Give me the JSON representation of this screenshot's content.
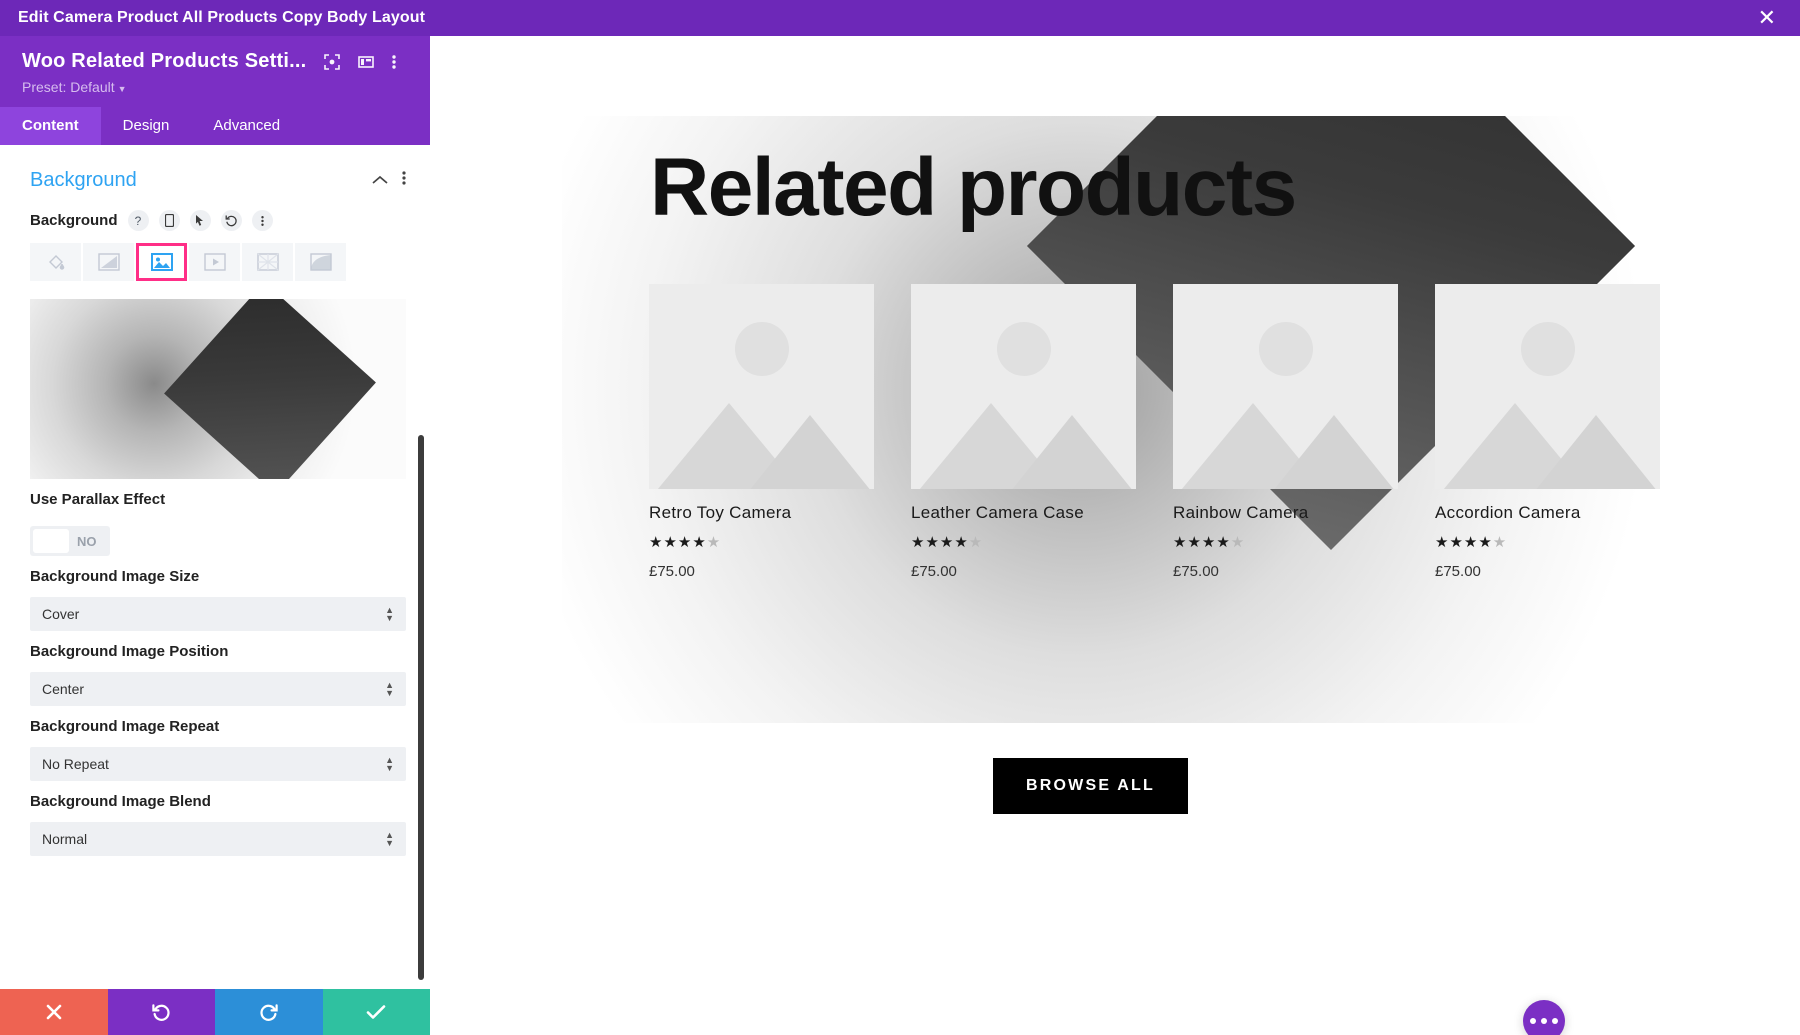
{
  "topbar": {
    "title": "Edit Camera Product All Products Copy Body Layout",
    "close_icon": "close-icon",
    "background_color": "#6D28B8"
  },
  "panel": {
    "module_title": "Woo Related Products Setti...",
    "preset_label": "Preset: Default",
    "header_icons": [
      {
        "name": "focus-target-icon"
      },
      {
        "name": "layout-columns-icon"
      },
      {
        "name": "more-vertical-icon"
      }
    ],
    "tabs": [
      {
        "label": "Content",
        "active": true
      },
      {
        "label": "Design",
        "active": false
      },
      {
        "label": "Advanced",
        "active": false
      }
    ],
    "section": {
      "title": "Background",
      "collapse_icon": "chevron-up-icon",
      "options_icon": "more-vertical-icon"
    },
    "background_field": {
      "label": "Background",
      "mini_icons": [
        {
          "name": "help-icon",
          "glyph": "?"
        },
        {
          "name": "responsive-mobile-icon"
        },
        {
          "name": "hover-cursor-icon"
        },
        {
          "name": "reset-undo-icon"
        },
        {
          "name": "more-vertical-icon"
        }
      ],
      "types": [
        {
          "name": "background-color-icon",
          "selected": false
        },
        {
          "name": "background-gradient-icon",
          "selected": false
        },
        {
          "name": "background-image-icon",
          "selected": true
        },
        {
          "name": "background-video-icon",
          "selected": false
        },
        {
          "name": "background-pattern-icon",
          "selected": false
        },
        {
          "name": "background-mask-icon",
          "selected": false
        }
      ],
      "selected_highlight_color": "#FF2E87"
    },
    "parallax": {
      "label": "Use Parallax Effect",
      "value": "NO"
    },
    "selects": [
      {
        "label": "Background Image Size",
        "value": "Cover"
      },
      {
        "label": "Background Image Position",
        "value": "Center"
      },
      {
        "label": "Background Image Repeat",
        "value": "No Repeat"
      },
      {
        "label": "Background Image Blend",
        "value": "Normal"
      }
    ],
    "actions": [
      {
        "name": "cancel-button",
        "icon": "close-icon",
        "color": "#EE6352"
      },
      {
        "name": "undo-button",
        "icon": "undo-icon",
        "color": "#7B2FC4"
      },
      {
        "name": "redo-button",
        "icon": "redo-icon",
        "color": "#2C8FD8"
      },
      {
        "name": "save-button",
        "icon": "check-icon",
        "color": "#2FC1A0"
      }
    ]
  },
  "preview": {
    "heading": "Related products",
    "products": [
      {
        "name": "Retro Toy Camera",
        "rating_filled": 4,
        "rating_total": 5,
        "price": "£75.00"
      },
      {
        "name": "Leather Camera Case",
        "rating_filled": 4,
        "rating_total": 5,
        "price": "£75.00"
      },
      {
        "name": "Rainbow Camera",
        "rating_filled": 4,
        "rating_total": 5,
        "price": "£75.00"
      },
      {
        "name": "Accordion Camera",
        "rating_filled": 4,
        "rating_total": 5,
        "price": "£75.00"
      }
    ],
    "browse_button": "BROWSE ALL",
    "fab_icon": "more-horizontal-icon",
    "fab_color": "#7B2FC4"
  }
}
